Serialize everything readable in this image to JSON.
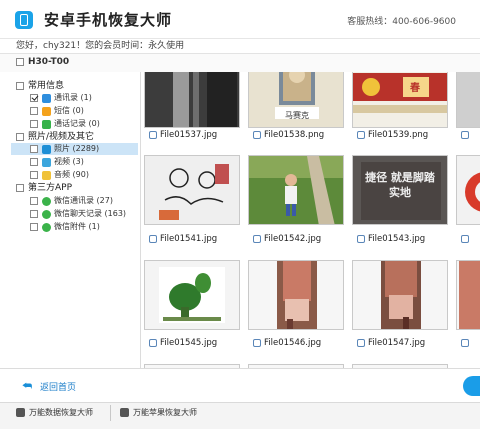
{
  "app": {
    "title": "安卓手机恢复大师",
    "hotline": "客服热线：400-606-9600",
    "greeting": "您好，chy321！您的会员时间：永久使用",
    "device": "H30-T00"
  },
  "sidebar": {
    "categories": [
      {
        "label": "常用信息",
        "items": [
          {
            "label": "通讯录 (1)",
            "icon": "contacts-icon",
            "checked": true
          },
          {
            "label": "短信 (0)",
            "icon": "sms-icon",
            "checked": false
          },
          {
            "label": "通话记录 (0)",
            "icon": "call-log-icon",
            "checked": false
          }
        ]
      },
      {
        "label": "照片/视频及其它",
        "items": [
          {
            "label": "照片 (2289)",
            "icon": "photo-icon",
            "checked": false,
            "selected": true
          },
          {
            "label": "视频 (3)",
            "icon": "video-icon",
            "checked": false
          },
          {
            "label": "音频 (90)",
            "icon": "audio-icon",
            "checked": false
          }
        ]
      },
      {
        "label": "第三方APP",
        "items": [
          {
            "label": "微信通讯录 (27)",
            "icon": "wechat-icon",
            "checked": false
          },
          {
            "label": "微信聊天记录 (163)",
            "icon": "wechat-icon",
            "checked": false
          },
          {
            "label": "微信附件 (1)",
            "icon": "wechat-icon",
            "checked": false
          }
        ]
      }
    ]
  },
  "files": [
    {
      "name": "File01537.jpg"
    },
    {
      "name": "File01538.png",
      "thumb_text": "马赛克"
    },
    {
      "name": "File01539.png",
      "thumb_text": "春"
    },
    {
      "name": "File01541.jpg"
    },
    {
      "name": "File01542.jpg"
    },
    {
      "name": "File01543.jpg",
      "thumb_text": "捷径 就是脚踏实地"
    },
    {
      "name": "File01545.jpg"
    },
    {
      "name": "File01546.jpg"
    },
    {
      "name": "File01547.jpg"
    }
  ],
  "bottom": {
    "back_label": "返回首页"
  },
  "footer": {
    "link1": "万能数据恢复大师",
    "link2": "万能苹果恢复大师"
  },
  "colors": {
    "accent": "#1a9de8",
    "selected_row": "#cce4f7"
  }
}
